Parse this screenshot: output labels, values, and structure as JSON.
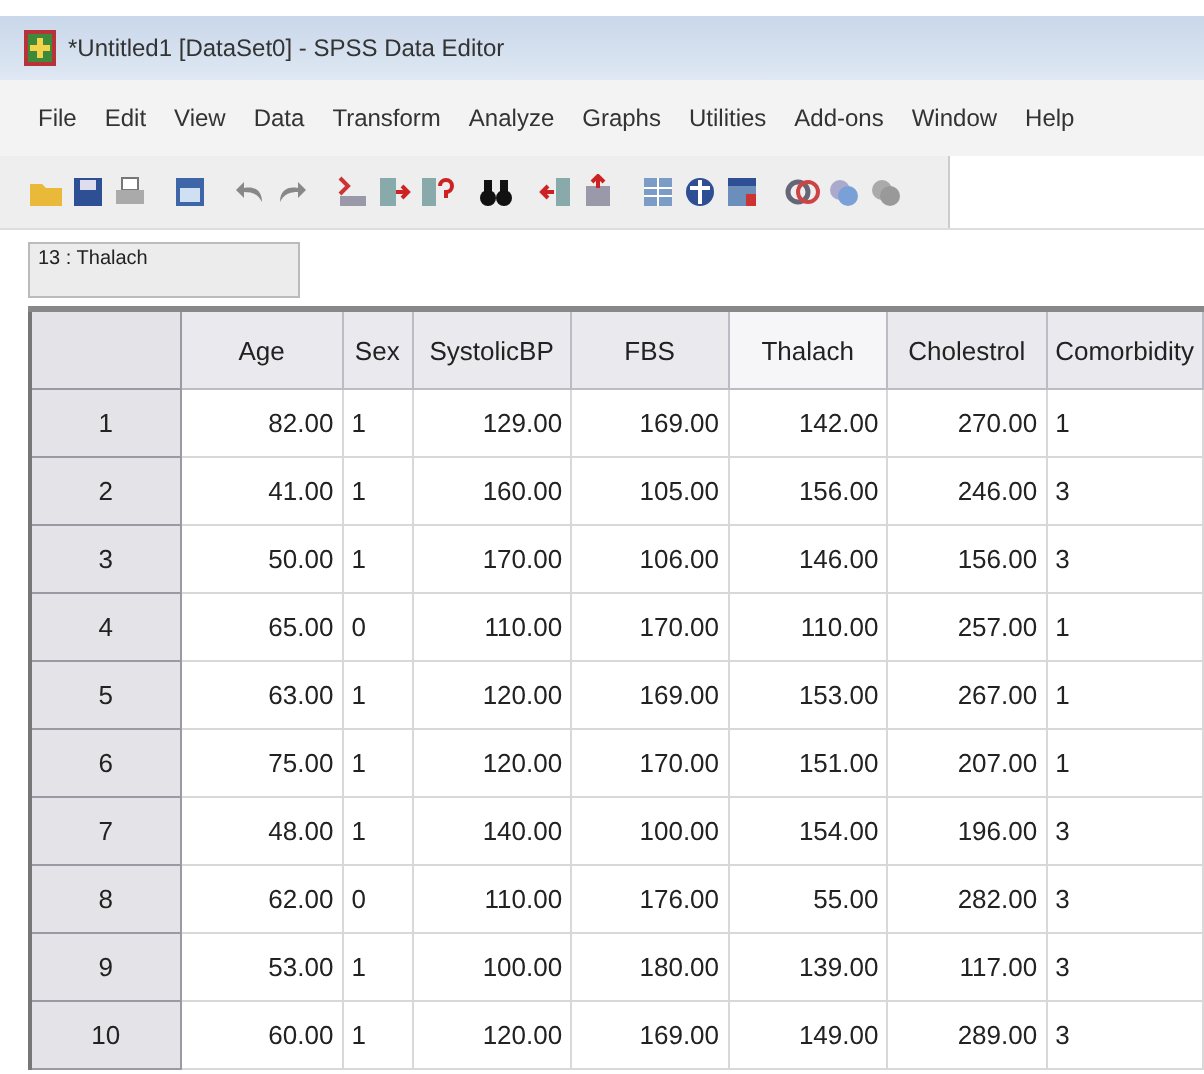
{
  "window": {
    "title": "*Untitled1 [DataSet0] - SPSS Data Editor"
  },
  "menu": [
    "File",
    "Edit",
    "View",
    "Data",
    "Transform",
    "Analyze",
    "Graphs",
    "Utilities",
    "Add-ons",
    "Window",
    "Help"
  ],
  "cell_reference": "13 : Thalach",
  "table": {
    "columns": [
      {
        "label": "Age",
        "kind": "numeric",
        "selected": false
      },
      {
        "label": "Sex",
        "kind": "nominal",
        "selected": false
      },
      {
        "label": "SystolicBP",
        "kind": "numeric",
        "selected": false
      },
      {
        "label": "FBS",
        "kind": "numeric",
        "selected": false
      },
      {
        "label": "Thalach",
        "kind": "numeric",
        "selected": true
      },
      {
        "label": "Cholestrol",
        "kind": "numeric",
        "selected": false
      },
      {
        "label": "Comorbidity",
        "kind": "nominal",
        "selected": false
      }
    ],
    "rows": [
      {
        "number": "1",
        "cells": [
          "82.00",
          "1",
          "129.00",
          "169.00",
          "142.00",
          "270.00",
          "1"
        ]
      },
      {
        "number": "2",
        "cells": [
          "41.00",
          "1",
          "160.00",
          "105.00",
          "156.00",
          "246.00",
          "3"
        ]
      },
      {
        "number": "3",
        "cells": [
          "50.00",
          "1",
          "170.00",
          "106.00",
          "146.00",
          "156.00",
          "3"
        ]
      },
      {
        "number": "4",
        "cells": [
          "65.00",
          "0",
          "110.00",
          "170.00",
          "110.00",
          "257.00",
          "1"
        ]
      },
      {
        "number": "5",
        "cells": [
          "63.00",
          "1",
          "120.00",
          "169.00",
          "153.00",
          "267.00",
          "1"
        ]
      },
      {
        "number": "6",
        "cells": [
          "75.00",
          "1",
          "120.00",
          "170.00",
          "151.00",
          "207.00",
          "1"
        ]
      },
      {
        "number": "7",
        "cells": [
          "48.00",
          "1",
          "140.00",
          "100.00",
          "154.00",
          "196.00",
          "3"
        ]
      },
      {
        "number": "8",
        "cells": [
          "62.00",
          "0",
          "110.00",
          "176.00",
          "55.00",
          "282.00",
          "3"
        ]
      },
      {
        "number": "9",
        "cells": [
          "53.00",
          "1",
          "100.00",
          "180.00",
          "139.00",
          "117.00",
          "3"
        ]
      },
      {
        "number": "10",
        "cells": [
          "60.00",
          "1",
          "120.00",
          "169.00",
          "149.00",
          "289.00",
          "3"
        ]
      }
    ]
  }
}
